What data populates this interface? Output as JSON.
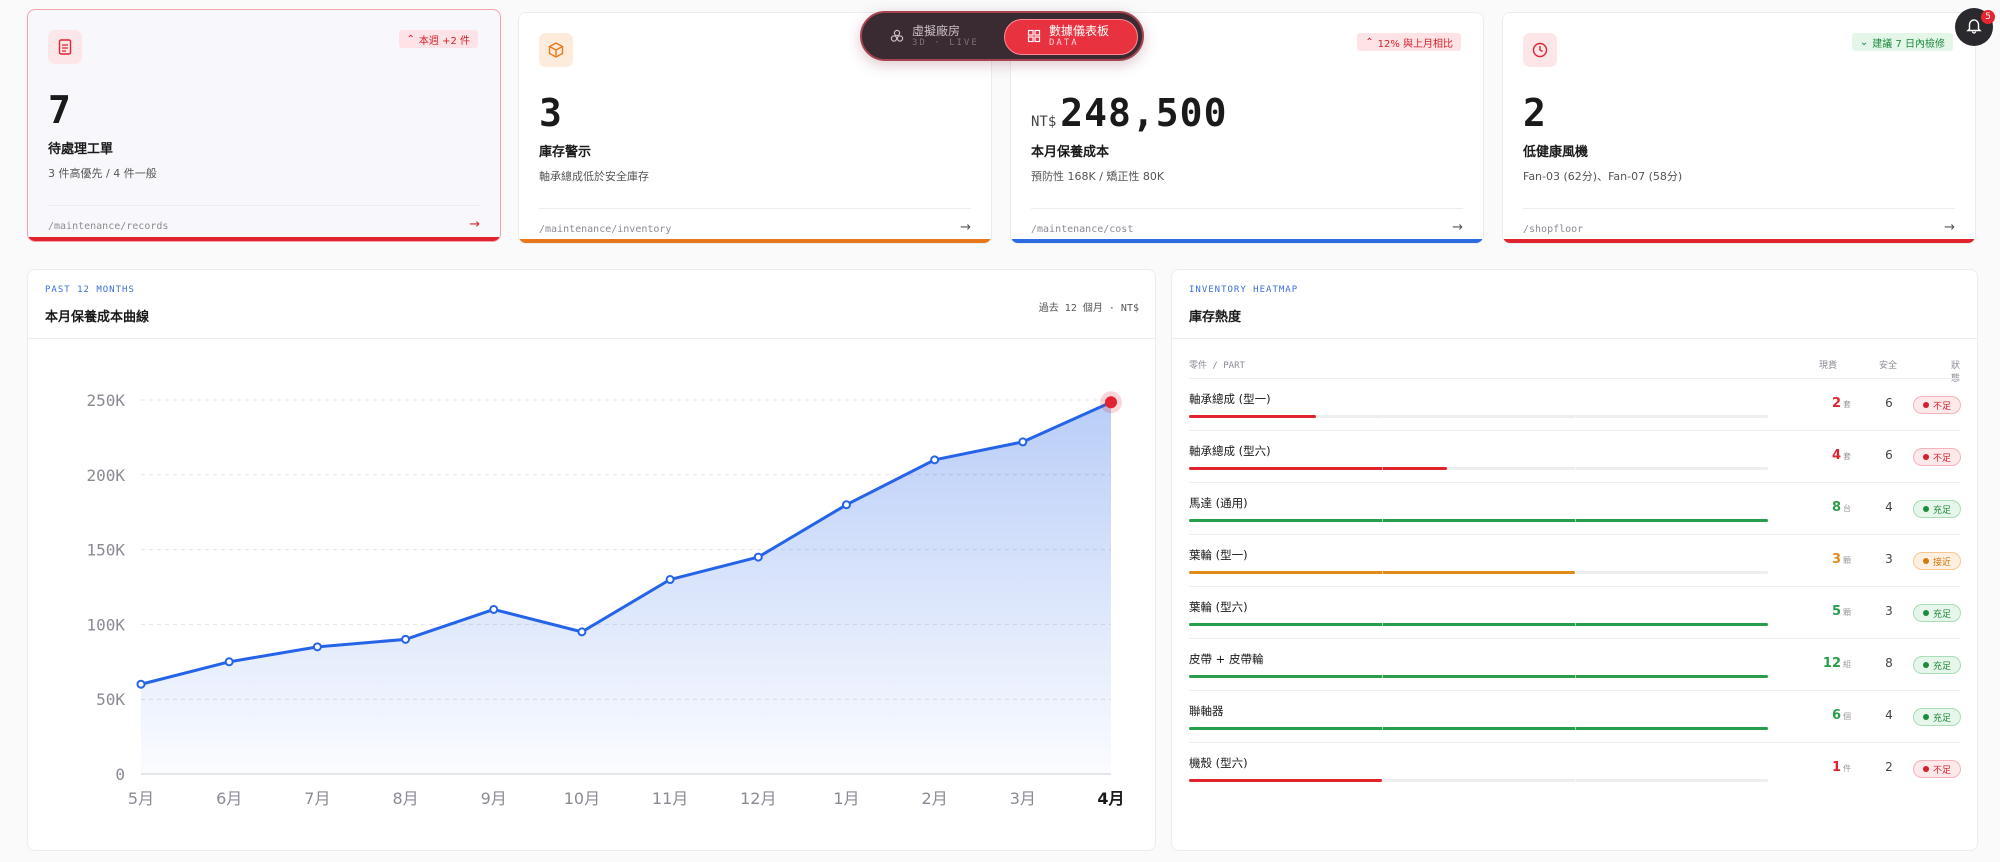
{
  "toggle": {
    "left": {
      "title": "虛擬廠房",
      "sub": "3D · LIVE"
    },
    "right": {
      "title": "數據儀表板",
      "sub": "DATA"
    }
  },
  "bell": {
    "count": "5"
  },
  "kpis": [
    {
      "badge": "本週 +2 件",
      "value": "7",
      "currency": "",
      "label": "待處理工單",
      "sub": "3 件高優先 / 4 件一般",
      "link": "/maintenance/records",
      "color": "#e0232f"
    },
    {
      "badge": "",
      "value": "3",
      "currency": "",
      "label": "庫存警示",
      "sub": "軸承總成低於安全庫存",
      "link": "/maintenance/inventory",
      "color": "#e8761a"
    },
    {
      "badge": "12% 與上月相比",
      "value": "248,500",
      "currency": "NT$",
      "label": "本月保養成本",
      "sub": "預防性 168K / 矯正性 80K",
      "link": "/maintenance/cost",
      "color": "#2c6be0"
    },
    {
      "badge": "建議 7 日內檢修",
      "value": "2",
      "currency": "",
      "label": "低健康風機",
      "sub": "Fan-03 (62分)、Fan-07 (58分)",
      "link": "/shopfloor",
      "color": "#e0232f"
    }
  ],
  "cost_panel": {
    "eyebrow": "PAST 12 MONTHS",
    "title": "本月保養成本曲線",
    "meta": "過去 12 個月 · NT$"
  },
  "chart_data": {
    "type": "area",
    "categories": [
      "5月",
      "6月",
      "7月",
      "8月",
      "9月",
      "10月",
      "11月",
      "12月",
      "1月",
      "2月",
      "3月",
      "4月"
    ],
    "values": [
      60000,
      75000,
      85000,
      90000,
      110000,
      95000,
      130000,
      145000,
      180000,
      210000,
      222000,
      248500
    ],
    "ylim": [
      0,
      250000
    ],
    "yticks": [
      0,
      50000,
      100000,
      150000,
      200000,
      250000
    ],
    "ytick_labels": [
      "0",
      "50K",
      "100K",
      "150K",
      "200K",
      "250K"
    ],
    "grid": true,
    "line_color": "#2563e8",
    "highlight_color": "#e0232f"
  },
  "inv_panel": {
    "eyebrow": "INVENTORY HEATMAP",
    "title": "庫存熱度",
    "headers": {
      "part": "零件 / PART",
      "stock": "現貨",
      "safe": "安全",
      "status": "狀態"
    },
    "rows": [
      {
        "name": "軸承總成 (型一)",
        "stock": "2",
        "unit": "套",
        "safe": "6",
        "status": "不足",
        "level": 0.22,
        "color": "#e0232f"
      },
      {
        "name": "軸承總成 (型六)",
        "stock": "4",
        "unit": "套",
        "safe": "6",
        "status": "不足",
        "level": 0.445,
        "color": "#e0232f"
      },
      {
        "name": "馬達 (通用)",
        "stock": "8",
        "unit": "台",
        "safe": "4",
        "status": "充足",
        "level": 1.0,
        "color": "#2a9d4a"
      },
      {
        "name": "葉輪 (型一)",
        "stock": "3",
        "unit": "顆",
        "safe": "3",
        "status": "接近",
        "level": 0.667,
        "color": "#e08a1a"
      },
      {
        "name": "葉輪 (型六)",
        "stock": "5",
        "unit": "顆",
        "safe": "3",
        "status": "充足",
        "level": 1.0,
        "color": "#2a9d4a"
      },
      {
        "name": "皮帶 + 皮帶輪",
        "stock": "12",
        "unit": "組",
        "safe": "8",
        "status": "充足",
        "level": 1.0,
        "color": "#2a9d4a"
      },
      {
        "name": "聯軸器",
        "stock": "6",
        "unit": "個",
        "safe": "4",
        "status": "充足",
        "level": 1.0,
        "color": "#2a9d4a"
      },
      {
        "name": "機殼 (型六)",
        "stock": "1",
        "unit": "件",
        "safe": "2",
        "status": "不足",
        "level": 0.333,
        "color": "#e0232f"
      }
    ]
  }
}
